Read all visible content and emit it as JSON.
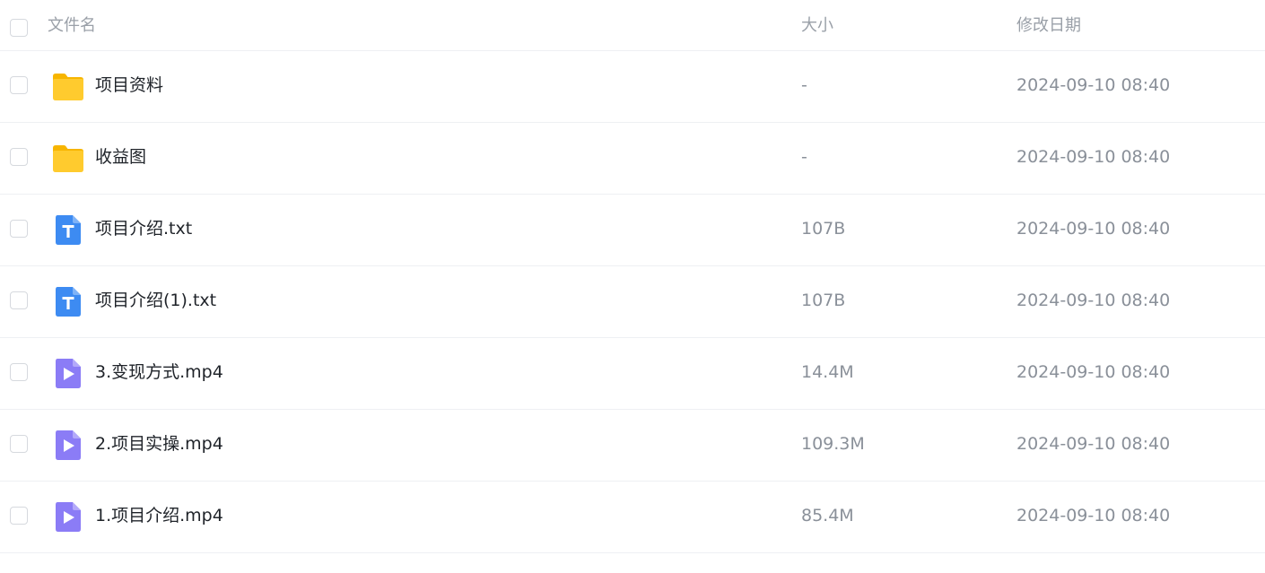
{
  "header": {
    "name_label": "文件名",
    "size_label": "大小",
    "date_label": "修改日期"
  },
  "files": [
    {
      "name": "项目资料",
      "size": "-",
      "date": "2024-09-10 08:40",
      "icon": "folder-icon"
    },
    {
      "name": "收益图",
      "size": "-",
      "date": "2024-09-10 08:40",
      "icon": "folder-icon"
    },
    {
      "name": "项目介绍.txt",
      "size": "107B",
      "date": "2024-09-10 08:40",
      "icon": "text-file-icon"
    },
    {
      "name": "项目介绍(1).txt",
      "size": "107B",
      "date": "2024-09-10 08:40",
      "icon": "text-file-icon"
    },
    {
      "name": "3.变现方式.mp4",
      "size": "14.4M",
      "date": "2024-09-10 08:40",
      "icon": "video-file-icon"
    },
    {
      "name": "2.项目实操.mp4",
      "size": "109.3M",
      "date": "2024-09-10 08:40",
      "icon": "video-file-icon"
    },
    {
      "name": "1.项目介绍.mp4",
      "size": "85.4M",
      "date": "2024-09-10 08:40",
      "icon": "video-file-icon"
    }
  ],
  "colors": {
    "folder": "#FFCB2E",
    "folder_tab": "#F7B500",
    "text_file": "#3D8BF2",
    "video_file": "#8B7CF6",
    "divider": "#EEF0F3"
  }
}
